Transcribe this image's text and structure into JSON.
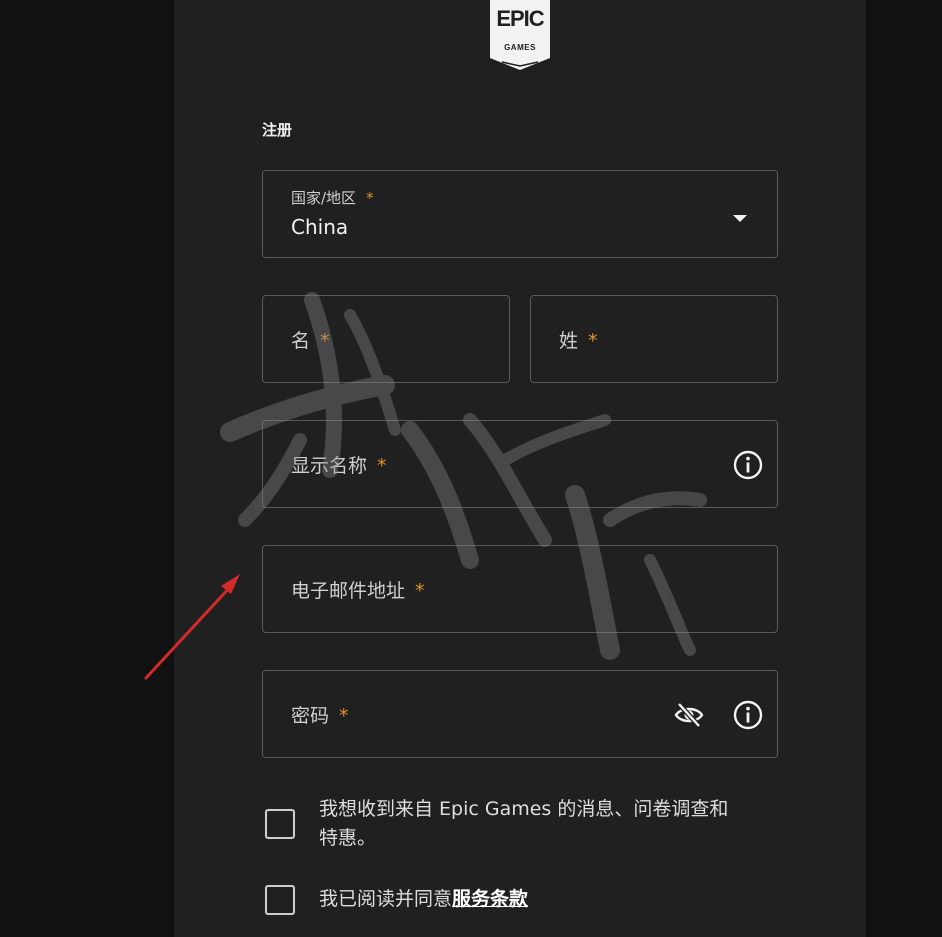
{
  "logo": {
    "main": "EPIC",
    "sub": "GAMES"
  },
  "form": {
    "title": "注册",
    "country": {
      "label": "国家/地区",
      "required_mark": "*",
      "value": "China"
    },
    "first_name": {
      "label": "名",
      "required_mark": "*"
    },
    "last_name": {
      "label": "姓",
      "required_mark": "*"
    },
    "display_name": {
      "label": "显示名称",
      "required_mark": "*"
    },
    "email": {
      "label": "电子邮件地址",
      "required_mark": "*"
    },
    "password": {
      "label": "密码",
      "required_mark": "*"
    },
    "newsletter": {
      "line1": "我想收到来自 Epic Games 的消息、问卷调查和",
      "line2": "特惠。",
      "checked": false
    },
    "terms": {
      "prefix": "我已阅读并同意",
      "link": "服务条款",
      "checked": false
    }
  },
  "icons": {
    "info": "info-icon",
    "password_visibility": "eye-slash-icon",
    "dropdown": "chevron-down-icon"
  },
  "colors": {
    "background": "#202020",
    "required": "#e0922f",
    "border": "#5a5a5a",
    "annotation_arrow": "#d42a2a"
  }
}
